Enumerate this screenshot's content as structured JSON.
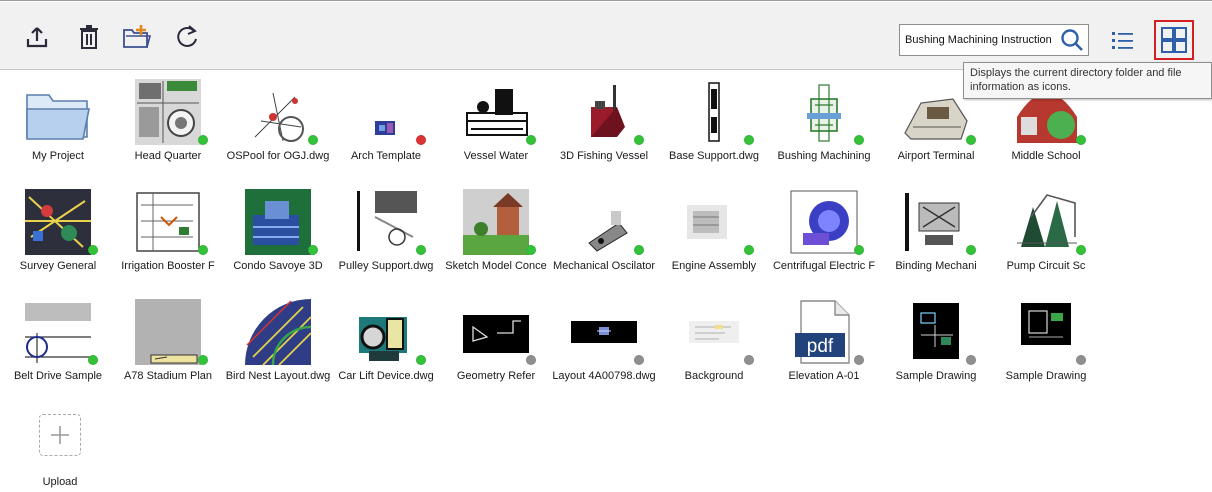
{
  "toolbar": {
    "icons": [
      "upload-icon",
      "trash-icon",
      "new-folder-icon",
      "refresh-icon",
      "search-icon",
      "list-view-icon",
      "icon-view-icon"
    ],
    "search_value": "Bushing Machining Instructions",
    "accent": "#2f5fa8",
    "highlight": "#d32020"
  },
  "tooltip": {
    "text": "Displays the current directory folder and file information as icons."
  },
  "files": [
    {
      "label": "My Project",
      "kind": "folder",
      "status": "none"
    },
    {
      "label": "Head Quarter",
      "kind": "map",
      "status": "green"
    },
    {
      "label": "OSPool for OGJ.dwg",
      "kind": "wire",
      "status": "green"
    },
    {
      "label": "Arch Template",
      "kind": "small",
      "status": "red"
    },
    {
      "label": "Vessel Water",
      "kind": "machine",
      "status": "green"
    },
    {
      "label": "3D Fishing Vessel",
      "kind": "red3d",
      "status": "green"
    },
    {
      "label": "Base Support.dwg",
      "kind": "tall",
      "status": "green"
    },
    {
      "label": "Bushing Machining",
      "kind": "part",
      "status": "green"
    },
    {
      "label": "Airport Terminal",
      "kind": "building",
      "status": "green"
    },
    {
      "label": "Middle School",
      "kind": "redgreen",
      "status": "green"
    },
    {
      "label": "Survey General",
      "kind": "survey",
      "status": "green"
    },
    {
      "label": "Irrigation Booster F",
      "kind": "schematic",
      "status": "green"
    },
    {
      "label": "Condo Savoye 3D",
      "kind": "condo",
      "status": "green"
    },
    {
      "label": "Pulley Support.dwg",
      "kind": "pulley",
      "status": "green"
    },
    {
      "label": "Sketch Model Conce",
      "kind": "house",
      "status": "green"
    },
    {
      "label": "Mechanical Oscilator",
      "kind": "mech",
      "status": "green"
    },
    {
      "label": "Engine Assembly",
      "kind": "engine",
      "status": "green"
    },
    {
      "label": "Centrifugal Electric F",
      "kind": "pump",
      "status": "green"
    },
    {
      "label": "Binding Mechani",
      "kind": "binding",
      "status": "green"
    },
    {
      "label": "Pump Circuit Sc",
      "kind": "cones",
      "status": "green"
    },
    {
      "label": "Belt Drive Sample",
      "kind": "belt",
      "status": "green"
    },
    {
      "label": "A78 Stadium Plan",
      "kind": "stadium",
      "status": "green"
    },
    {
      "label": "Bird Nest Layout.dwg",
      "kind": "nest",
      "status": "none"
    },
    {
      "label": "Car Lift Device.dwg",
      "kind": "carlift",
      "status": "green"
    },
    {
      "label": "Geometry Refer",
      "kind": "blackgeo",
      "status": "grey"
    },
    {
      "label": "Layout 4A00798.dwg",
      "kind": "blacklayout",
      "status": "grey"
    },
    {
      "label": "Background",
      "kind": "background",
      "status": "grey"
    },
    {
      "label": "Elevation A-01",
      "kind": "pdf",
      "status": "grey"
    },
    {
      "label": "Sample Drawing",
      "kind": "blacksample",
      "status": "grey"
    },
    {
      "label": "Sample Drawing",
      "kind": "blacksample2",
      "status": "grey"
    }
  ],
  "pdf_text": "pdf",
  "upload": {
    "label": "Upload",
    "icon": "plus-icon"
  },
  "status_colors": {
    "green": "#33c23a",
    "red": "#d93434",
    "grey": "#8f8f8f"
  }
}
